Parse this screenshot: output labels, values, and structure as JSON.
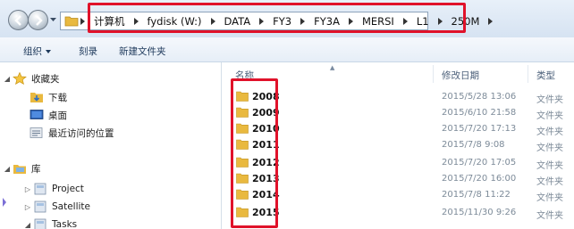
{
  "address_bar": {
    "breadcrumbs": [
      {
        "label": "计算机"
      },
      {
        "label": "fydisk (W:)"
      },
      {
        "label": "DATA"
      },
      {
        "label": "FY3"
      },
      {
        "label": "FY3A"
      },
      {
        "label": "MERSI"
      },
      {
        "label": "L1"
      },
      {
        "label": "250M"
      }
    ]
  },
  "toolbar": {
    "organize_label": "组织",
    "burn_label": "刻录",
    "new_folder_label": "新建文件夹"
  },
  "nav_pane": {
    "favorites": {
      "label": "收藏夹",
      "items": [
        {
          "label": "下载",
          "icon": "download-folder-icon"
        },
        {
          "label": "桌面",
          "icon": "desktop-icon"
        },
        {
          "label": "最近访问的位置",
          "icon": "recent-places-icon"
        }
      ]
    },
    "libraries": {
      "label": "库",
      "items": [
        {
          "label": "Project",
          "icon": "library-icon"
        },
        {
          "label": "Satellite",
          "icon": "library-icon"
        },
        {
          "label": "Tasks",
          "icon": "library-icon"
        }
      ]
    }
  },
  "columns": {
    "name": "名称",
    "date_modified": "修改日期",
    "type": "类型"
  },
  "files": [
    {
      "name": "2008",
      "date": "2015/5/28 13:06",
      "type": "文件夹"
    },
    {
      "name": "2009",
      "date": "2015/6/10 21:58",
      "type": "文件夹"
    },
    {
      "name": "2010",
      "date": "2015/7/20 17:13",
      "type": "文件夹"
    },
    {
      "name": "2011",
      "date": "2015/7/8 9:08",
      "type": "文件夹"
    },
    {
      "name": "2012",
      "date": "2015/7/20 17:05",
      "type": "文件夹"
    },
    {
      "name": "2013",
      "date": "2015/7/20 16:00",
      "type": "文件夹"
    },
    {
      "name": "2014",
      "date": "2015/7/8 11:22",
      "type": "文件夹"
    },
    {
      "name": "2015",
      "date": "2015/11/30 9:26",
      "type": "文件夹"
    }
  ],
  "colors": {
    "highlight_box": "#e0122a",
    "folder": "#e9b93f",
    "toolbar_text": "#1e395b",
    "secondary_text": "#7d8b99"
  }
}
